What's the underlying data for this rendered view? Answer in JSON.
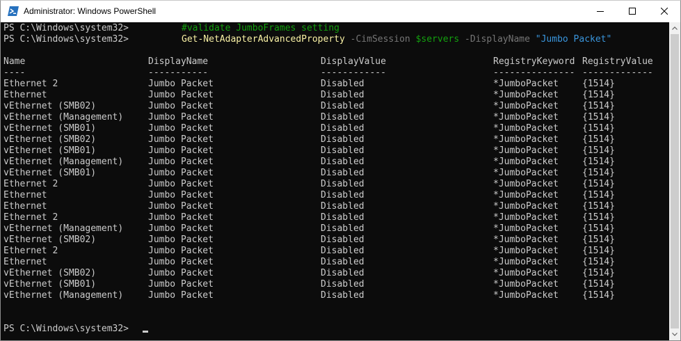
{
  "window": {
    "title": "Administrator: Windows PowerShell",
    "icons": {
      "app": "powershell-icon",
      "minimize": "minimize-icon",
      "maximize": "maximize-icon",
      "close": "close-icon"
    }
  },
  "console": {
    "prompt": "PS C:\\Windows\\system32>",
    "line1_comment": "#validate JumboFrames setting",
    "line2": {
      "cmdlet": "Get-NetAdapterAdvancedProperty",
      "param1": "-CimSession",
      "var1": "$servers",
      "param2": "-DisplayName",
      "string1": "\"Jumbo Packet\""
    },
    "headers": [
      "Name",
      "DisplayName",
      "DisplayValue",
      "RegistryKeyword",
      "RegistryValue"
    ],
    "underlines": [
      "----",
      "-----------",
      "------------",
      "---------------",
      "-------------"
    ],
    "rows": [
      [
        "Ethernet 2",
        "Jumbo Packet",
        "Disabled",
        "*JumboPacket",
        "{1514}"
      ],
      [
        "Ethernet",
        "Jumbo Packet",
        "Disabled",
        "*JumboPacket",
        "{1514}"
      ],
      [
        "vEthernet (SMB02)",
        "Jumbo Packet",
        "Disabled",
        "*JumboPacket",
        "{1514}"
      ],
      [
        "vEthernet (Management)",
        "Jumbo Packet",
        "Disabled",
        "*JumboPacket",
        "{1514}"
      ],
      [
        "vEthernet (SMB01)",
        "Jumbo Packet",
        "Disabled",
        "*JumboPacket",
        "{1514}"
      ],
      [
        "vEthernet (SMB02)",
        "Jumbo Packet",
        "Disabled",
        "*JumboPacket",
        "{1514}"
      ],
      [
        "vEthernet (SMB01)",
        "Jumbo Packet",
        "Disabled",
        "*JumboPacket",
        "{1514}"
      ],
      [
        "vEthernet (Management)",
        "Jumbo Packet",
        "Disabled",
        "*JumboPacket",
        "{1514}"
      ],
      [
        "vEthernet (SMB01)",
        "Jumbo Packet",
        "Disabled",
        "*JumboPacket",
        "{1514}"
      ],
      [
        "Ethernet 2",
        "Jumbo Packet",
        "Disabled",
        "*JumboPacket",
        "{1514}"
      ],
      [
        "Ethernet",
        "Jumbo Packet",
        "Disabled",
        "*JumboPacket",
        "{1514}"
      ],
      [
        "Ethernet",
        "Jumbo Packet",
        "Disabled",
        "*JumboPacket",
        "{1514}"
      ],
      [
        "Ethernet 2",
        "Jumbo Packet",
        "Disabled",
        "*JumboPacket",
        "{1514}"
      ],
      [
        "vEthernet (Management)",
        "Jumbo Packet",
        "Disabled",
        "*JumboPacket",
        "{1514}"
      ],
      [
        "vEthernet (SMB02)",
        "Jumbo Packet",
        "Disabled",
        "*JumboPacket",
        "{1514}"
      ],
      [
        "Ethernet 2",
        "Jumbo Packet",
        "Disabled",
        "*JumboPacket",
        "{1514}"
      ],
      [
        "Ethernet",
        "Jumbo Packet",
        "Disabled",
        "*JumboPacket",
        "{1514}"
      ],
      [
        "vEthernet (SMB02)",
        "Jumbo Packet",
        "Disabled",
        "*JumboPacket",
        "{1514}"
      ],
      [
        "vEthernet (SMB01)",
        "Jumbo Packet",
        "Disabled",
        "*JumboPacket",
        "{1514}"
      ],
      [
        "vEthernet (Management)",
        "Jumbo Packet",
        "Disabled",
        "*JumboPacket",
        "{1514}"
      ]
    ]
  },
  "colors": {
    "background": "#0c0c0c",
    "text": "#cccccc",
    "comment": "#13a10e",
    "cmdlet": "#f9f1a5",
    "parameter": "#767676",
    "variable": "#13a10e",
    "string": "#3a96dd"
  }
}
